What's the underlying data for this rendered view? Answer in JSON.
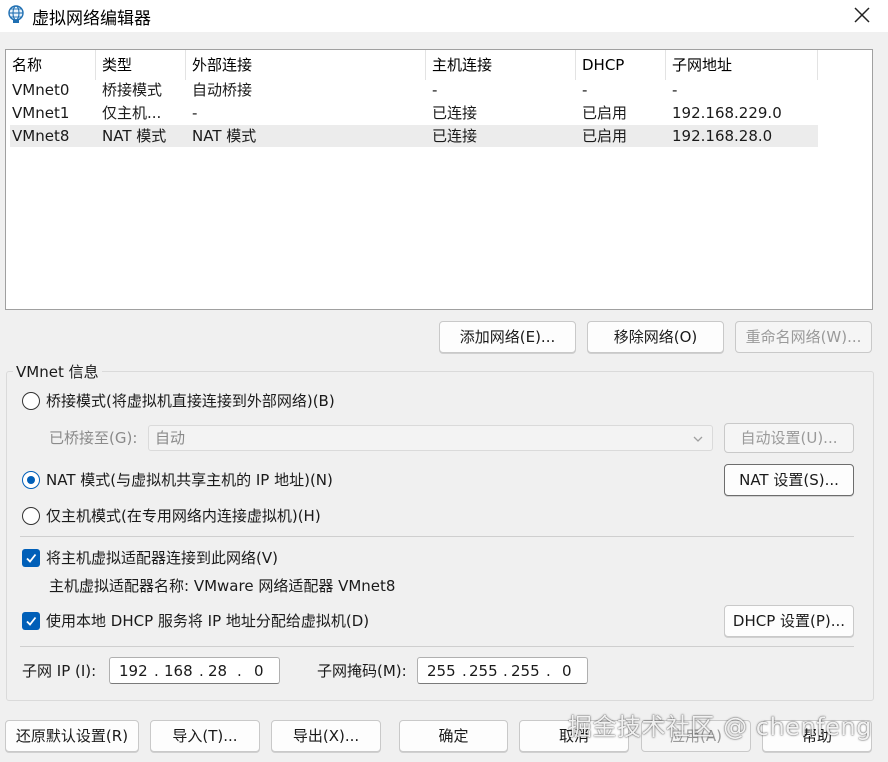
{
  "window": {
    "title": "虚拟网络编辑器",
    "app_icon": "globe-icon",
    "close_icon": "close-icon"
  },
  "networks": {
    "columns": [
      "名称",
      "类型",
      "外部连接",
      "主机连接",
      "DHCP",
      "子网地址"
    ],
    "rows": [
      {
        "name": "VMnet0",
        "type": "桥接模式",
        "external": "自动桥接",
        "host": "-",
        "dhcp": "-",
        "subnet": "-"
      },
      {
        "name": "VMnet1",
        "type": "仅主机...",
        "external": "-",
        "host": "已连接",
        "dhcp": "已启用",
        "subnet": "192.168.229.0"
      },
      {
        "name": "VMnet8",
        "type": "NAT 模式",
        "external": "NAT 模式",
        "host": "已连接",
        "dhcp": "已启用",
        "subnet": "192.168.28.0"
      }
    ],
    "selected_index": 2
  },
  "list_buttons": {
    "add": "添加网络(E)...",
    "remove": "移除网络(O)",
    "rename": "重命名网络(W)..."
  },
  "vmnet_info": {
    "title": "VMnet 信息",
    "bridged_label": "桥接模式(将虚拟机直接连接到外部网络)(B)",
    "bridged_to_label": "已桥接至(G):",
    "bridged_to_value": "自动",
    "auto_settings": "自动设置(U)...",
    "nat_label": "NAT 模式(与虚拟机共享主机的 IP 地址)(N)",
    "nat_settings": "NAT 设置(S)...",
    "hostonly_label": "仅主机模式(在专用网络内连接虚拟机)(H)",
    "selected_mode": "nat",
    "connect_adapter_label": "将主机虚拟适配器连接到此网络(V)",
    "connect_adapter_checked": true,
    "adapter_name_text": "主机虚拟适配器名称: VMware 网络适配器 VMnet8",
    "dhcp_label": "使用本地 DHCP 服务将 IP 地址分配给虚拟机(D)",
    "dhcp_checked": true,
    "dhcp_settings": "DHCP 设置(P)...",
    "subnet_ip_label": "子网 IP (I):",
    "subnet_ip": [
      "192",
      "168",
      "28",
      "0"
    ],
    "subnet_mask_label": "子网掩码(M):",
    "subnet_mask": [
      "255",
      "255",
      "255",
      "0"
    ]
  },
  "footer": {
    "restore": "还原默认设置(R)",
    "import": "导入(T)...",
    "export": "导出(X)...",
    "ok": "确定",
    "cancel": "取消",
    "apply": "应用(A)",
    "help": "帮助"
  },
  "watermark": "掘金技术社区 @ chenfeng",
  "colors": {
    "accent": "#005fb8",
    "selected_row": "#ececec",
    "disabled_text": "#9a9a9a"
  }
}
